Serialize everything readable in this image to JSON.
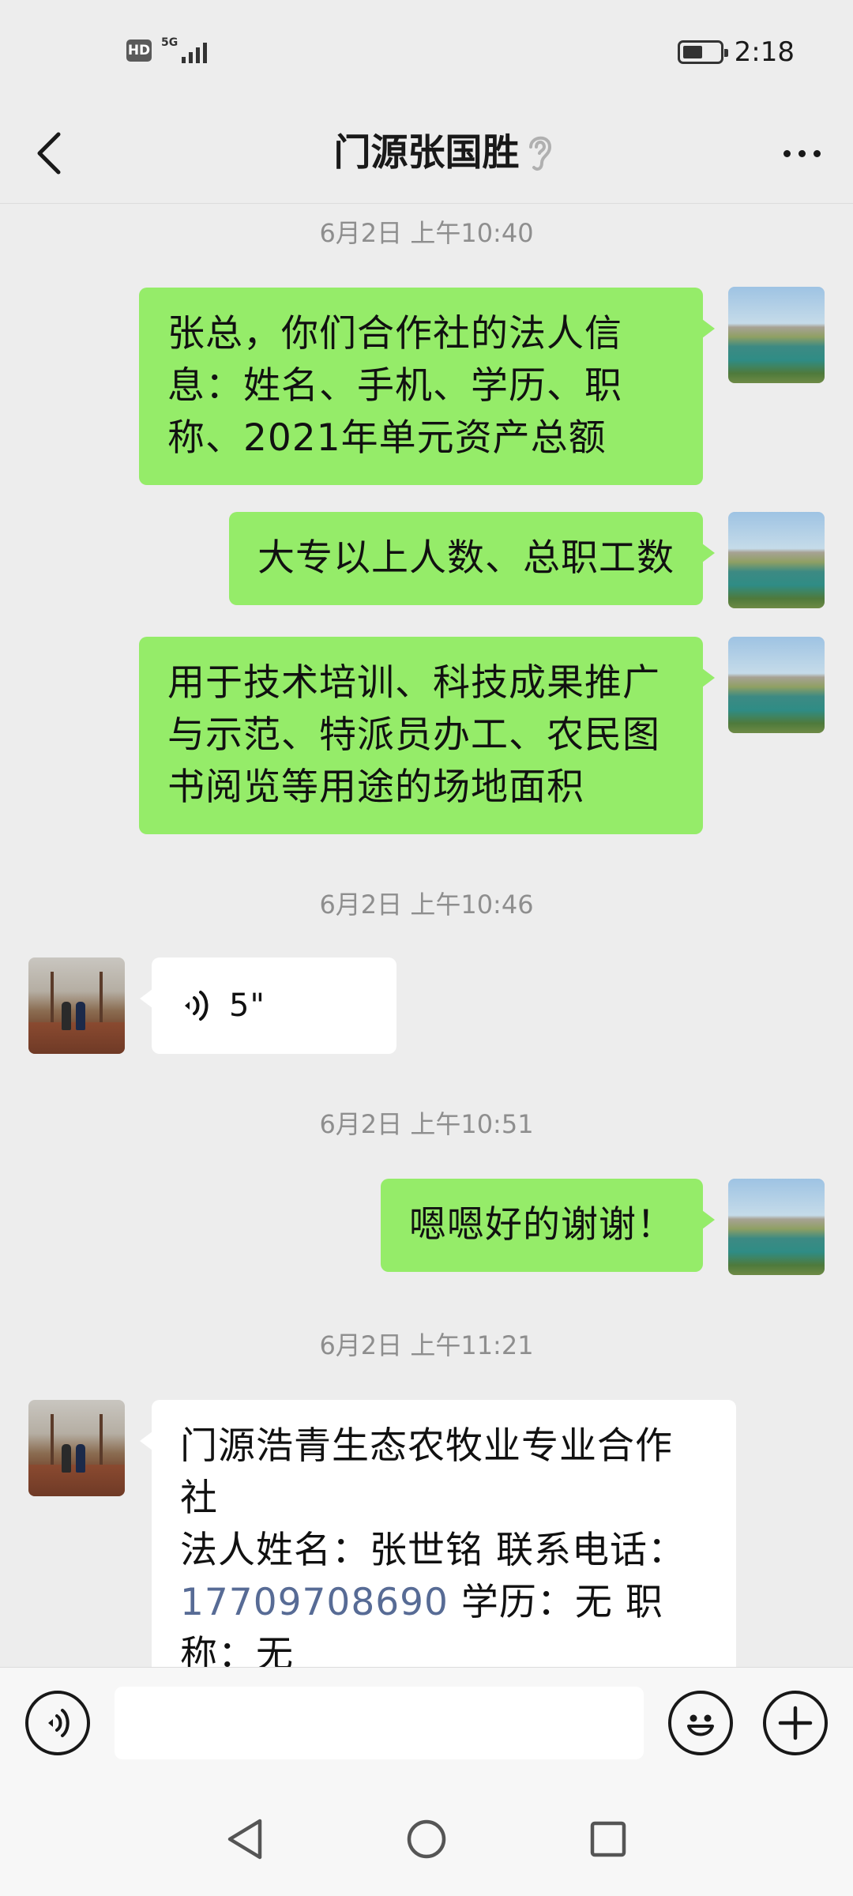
{
  "status_bar": {
    "hd": "HD",
    "network": "5G",
    "time": "2:18",
    "battery_level": 0.55
  },
  "header": {
    "title": "门源张国胜"
  },
  "messages": {
    "ts1": "6月2日 上午10:40",
    "m1": "张总，你们合作社的法人信息：姓名、手机、学历、职称、2021年单元资产总额",
    "m2": "大专以上人数、总职工数",
    "m3": "用于技术培训、科技成果推广与示范、特派员办工、农民图书阅览等用途的场地面积",
    "ts2": "6月2日 上午10:46",
    "voice_duration": "5\"",
    "ts3": "6月2日 上午10:51",
    "m4": "嗯嗯好的谢谢！",
    "ts4": "6月2日 上午11:21",
    "m5_line1": "门源浩青生态农牧业专业合作社",
    "m5_line2a": "法人姓名：张世铭  联系电话：",
    "m5_phone": "17709708690",
    "m5_line2b": " 学历：无  职称：无"
  },
  "input": {
    "placeholder": ""
  },
  "icons": {
    "back": "back-arrow-icon",
    "ear": "ear-icon",
    "more": "more-dots-icon",
    "voice": "voice-wave-icon",
    "emoji": "emoji-icon",
    "plus": "plus-icon",
    "nav_back": "triangle-back-icon",
    "home": "circle-home-icon",
    "recents": "square-recents-icon"
  },
  "colors": {
    "bg": "#ededed",
    "outgoing": "#95ec69",
    "incoming": "#ffffff",
    "link": "#576b95"
  }
}
